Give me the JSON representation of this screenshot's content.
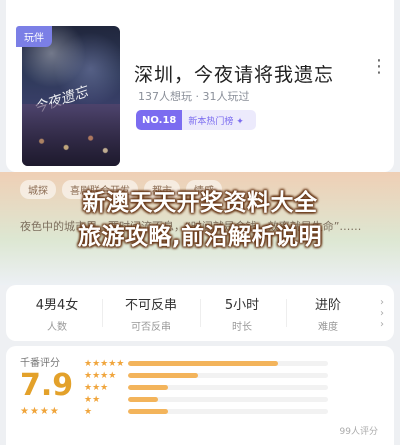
{
  "book": {
    "tag": "玩伴",
    "title": "深圳，今夜请将我遗忘",
    "meta": "137人想玩 · 31人玩过",
    "rank_no": "NO.18",
    "rank_label": "新本热门榜 ✦"
  },
  "overlay": {
    "line1": "新澳天天开奖资料大全",
    "line2": "旅游攻略,前沿解析说明",
    "chips": [
      "城探",
      "喜剧联合开发",
      "都市",
      "情感"
    ],
    "desc": "夜色中的城市里，要时间流不息，“时间就是金钱，效率就是生命”……"
  },
  "stats": [
    {
      "value": "4男4女",
      "label": "人数"
    },
    {
      "value": "不可反串",
      "label": "可否反串"
    },
    {
      "value": "5小时",
      "label": "时长"
    },
    {
      "value": "进阶",
      "label": "难度"
    }
  ],
  "rating": {
    "label": "千番评分",
    "score": "7.9",
    "stars": "★★★★",
    "bars": [
      {
        "stars": "★★★★★",
        "fill": 0.75
      },
      {
        "stars": "★★★★",
        "fill": 0.35
      },
      {
        "stars": "★★★",
        "fill": 0.2
      },
      {
        "stars": "★★",
        "fill": 0.15
      },
      {
        "stars": "★",
        "fill": 0.2
      }
    ],
    "count": "99人评分"
  },
  "colors": {
    "accent": "#7b6cf0",
    "score": "#e3a12a",
    "star": "#f0a53c"
  }
}
